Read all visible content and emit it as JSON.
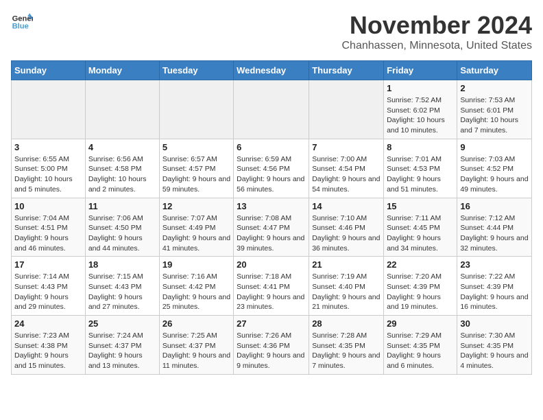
{
  "header": {
    "logo_line1": "General",
    "logo_line2": "Blue",
    "month": "November 2024",
    "location": "Chanhassen, Minnesota, United States"
  },
  "weekdays": [
    "Sunday",
    "Monday",
    "Tuesday",
    "Wednesday",
    "Thursday",
    "Friday",
    "Saturday"
  ],
  "weeks": [
    [
      {
        "day": "",
        "info": ""
      },
      {
        "day": "",
        "info": ""
      },
      {
        "day": "",
        "info": ""
      },
      {
        "day": "",
        "info": ""
      },
      {
        "day": "",
        "info": ""
      },
      {
        "day": "1",
        "info": "Sunrise: 7:52 AM\nSunset: 6:02 PM\nDaylight: 10 hours and 10 minutes."
      },
      {
        "day": "2",
        "info": "Sunrise: 7:53 AM\nSunset: 6:01 PM\nDaylight: 10 hours and 7 minutes."
      }
    ],
    [
      {
        "day": "3",
        "info": "Sunrise: 6:55 AM\nSunset: 5:00 PM\nDaylight: 10 hours and 5 minutes."
      },
      {
        "day": "4",
        "info": "Sunrise: 6:56 AM\nSunset: 4:58 PM\nDaylight: 10 hours and 2 minutes."
      },
      {
        "day": "5",
        "info": "Sunrise: 6:57 AM\nSunset: 4:57 PM\nDaylight: 9 hours and 59 minutes."
      },
      {
        "day": "6",
        "info": "Sunrise: 6:59 AM\nSunset: 4:56 PM\nDaylight: 9 hours and 56 minutes."
      },
      {
        "day": "7",
        "info": "Sunrise: 7:00 AM\nSunset: 4:54 PM\nDaylight: 9 hours and 54 minutes."
      },
      {
        "day": "8",
        "info": "Sunrise: 7:01 AM\nSunset: 4:53 PM\nDaylight: 9 hours and 51 minutes."
      },
      {
        "day": "9",
        "info": "Sunrise: 7:03 AM\nSunset: 4:52 PM\nDaylight: 9 hours and 49 minutes."
      }
    ],
    [
      {
        "day": "10",
        "info": "Sunrise: 7:04 AM\nSunset: 4:51 PM\nDaylight: 9 hours and 46 minutes."
      },
      {
        "day": "11",
        "info": "Sunrise: 7:06 AM\nSunset: 4:50 PM\nDaylight: 9 hours and 44 minutes."
      },
      {
        "day": "12",
        "info": "Sunrise: 7:07 AM\nSunset: 4:49 PM\nDaylight: 9 hours and 41 minutes."
      },
      {
        "day": "13",
        "info": "Sunrise: 7:08 AM\nSunset: 4:47 PM\nDaylight: 9 hours and 39 minutes."
      },
      {
        "day": "14",
        "info": "Sunrise: 7:10 AM\nSunset: 4:46 PM\nDaylight: 9 hours and 36 minutes."
      },
      {
        "day": "15",
        "info": "Sunrise: 7:11 AM\nSunset: 4:45 PM\nDaylight: 9 hours and 34 minutes."
      },
      {
        "day": "16",
        "info": "Sunrise: 7:12 AM\nSunset: 4:44 PM\nDaylight: 9 hours and 32 minutes."
      }
    ],
    [
      {
        "day": "17",
        "info": "Sunrise: 7:14 AM\nSunset: 4:43 PM\nDaylight: 9 hours and 29 minutes."
      },
      {
        "day": "18",
        "info": "Sunrise: 7:15 AM\nSunset: 4:43 PM\nDaylight: 9 hours and 27 minutes."
      },
      {
        "day": "19",
        "info": "Sunrise: 7:16 AM\nSunset: 4:42 PM\nDaylight: 9 hours and 25 minutes."
      },
      {
        "day": "20",
        "info": "Sunrise: 7:18 AM\nSunset: 4:41 PM\nDaylight: 9 hours and 23 minutes."
      },
      {
        "day": "21",
        "info": "Sunrise: 7:19 AM\nSunset: 4:40 PM\nDaylight: 9 hours and 21 minutes."
      },
      {
        "day": "22",
        "info": "Sunrise: 7:20 AM\nSunset: 4:39 PM\nDaylight: 9 hours and 19 minutes."
      },
      {
        "day": "23",
        "info": "Sunrise: 7:22 AM\nSunset: 4:39 PM\nDaylight: 9 hours and 16 minutes."
      }
    ],
    [
      {
        "day": "24",
        "info": "Sunrise: 7:23 AM\nSunset: 4:38 PM\nDaylight: 9 hours and 15 minutes."
      },
      {
        "day": "25",
        "info": "Sunrise: 7:24 AM\nSunset: 4:37 PM\nDaylight: 9 hours and 13 minutes."
      },
      {
        "day": "26",
        "info": "Sunrise: 7:25 AM\nSunset: 4:37 PM\nDaylight: 9 hours and 11 minutes."
      },
      {
        "day": "27",
        "info": "Sunrise: 7:26 AM\nSunset: 4:36 PM\nDaylight: 9 hours and 9 minutes."
      },
      {
        "day": "28",
        "info": "Sunrise: 7:28 AM\nSunset: 4:35 PM\nDaylight: 9 hours and 7 minutes."
      },
      {
        "day": "29",
        "info": "Sunrise: 7:29 AM\nSunset: 4:35 PM\nDaylight: 9 hours and 6 minutes."
      },
      {
        "day": "30",
        "info": "Sunrise: 7:30 AM\nSunset: 4:35 PM\nDaylight: 9 hours and 4 minutes."
      }
    ]
  ]
}
